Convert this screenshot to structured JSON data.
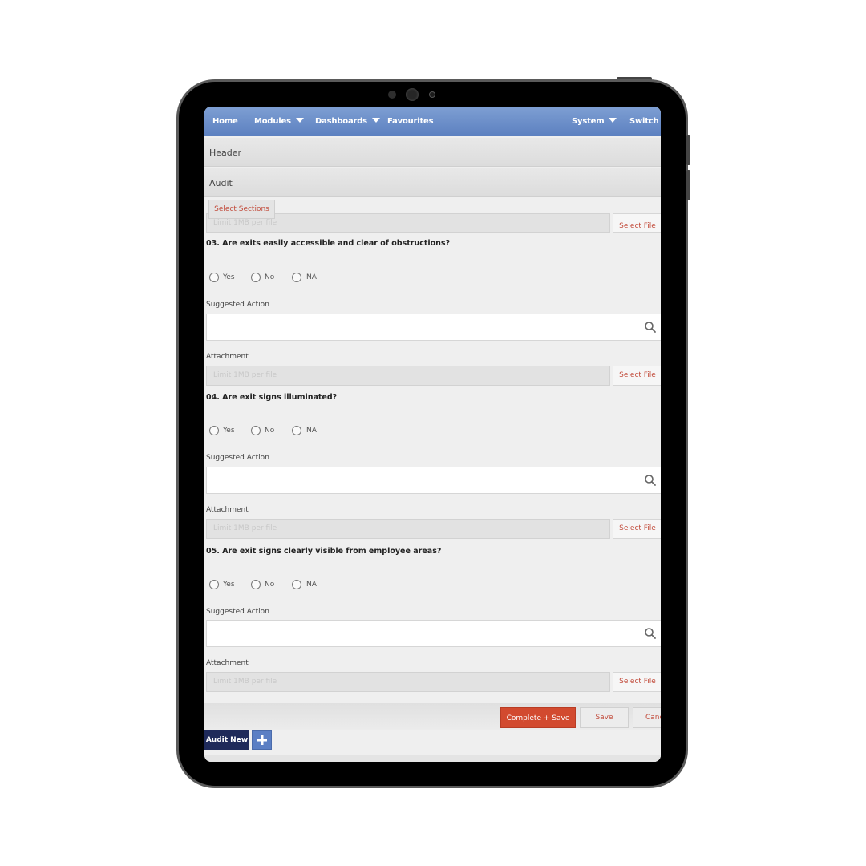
{
  "nav": {
    "home": "Home",
    "modules": "Modules",
    "dashboards": "Dashboards",
    "favourites": "Favourites",
    "system": "System",
    "switch": "Switch Cl"
  },
  "sections": {
    "header": "Header",
    "audit": "Audit",
    "select_sections": "Select Sections"
  },
  "attachment_placeholder": "Limit 1MB per file",
  "select_file": "Select File",
  "radio_options": [
    "Yes",
    "No",
    "NA"
  ],
  "labels": {
    "suggested_action": "Suggested Action",
    "attachment": "Attachment"
  },
  "questions": [
    "03. Are exits easily accessible and clear of obstructions?",
    "04. Are exit signs illuminated?",
    "05. Are exit signs clearly visible from employee areas?"
  ],
  "footer": {
    "complete_save": "Complete + Save",
    "save": "Save",
    "cancel": "Canc"
  },
  "bottom": {
    "audit_new": "Audit New"
  },
  "icons": [
    "search-icon",
    "plus-icon",
    "caret-down-icon"
  ],
  "colors": {
    "nav": "#6a8cc9",
    "accent_red": "#d24a2f",
    "link_red": "#c24b3b",
    "audit_new": "#1f2a5a"
  }
}
